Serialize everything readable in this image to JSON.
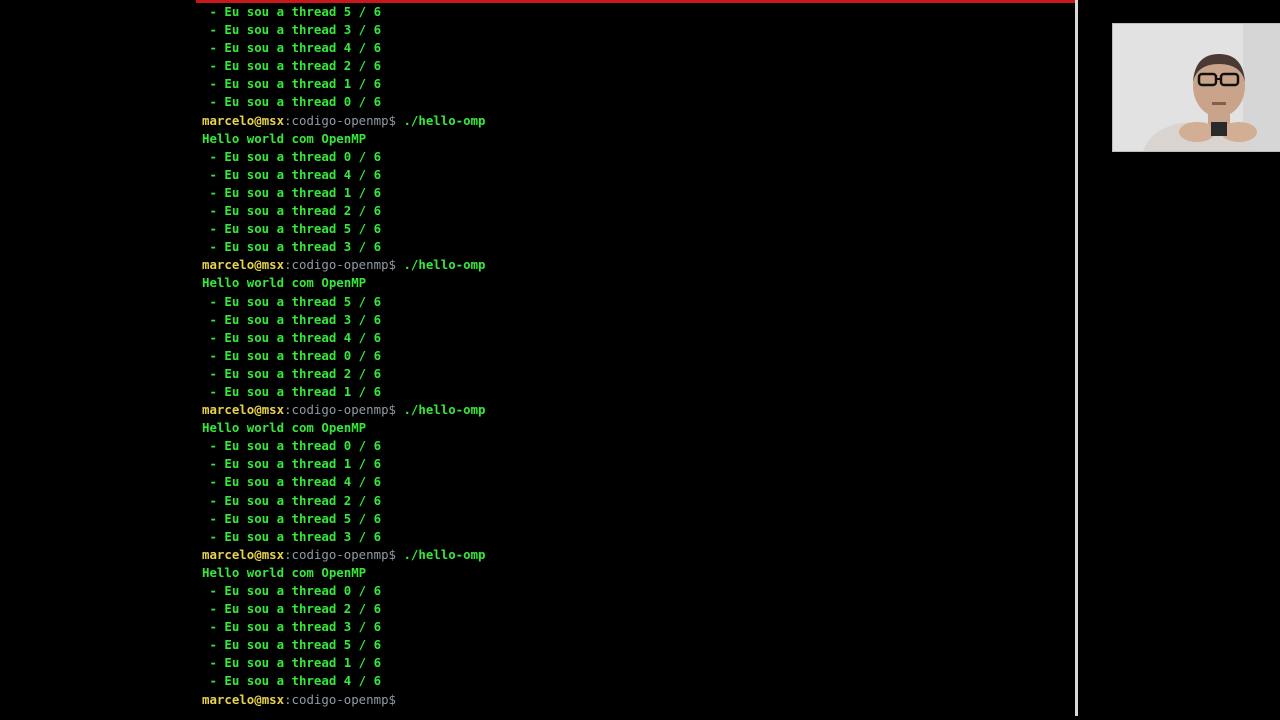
{
  "terminal": {
    "prompt": {
      "user": "marcelo",
      "at": "@",
      "host": "msx",
      "colon": ":",
      "path": "codigo-openmp",
      "dollar": "$"
    },
    "lines": [
      {
        "type": "output",
        "text": " - Eu sou a thread 5 / 6"
      },
      {
        "type": "output",
        "text": " - Eu sou a thread 3 / 6"
      },
      {
        "type": "output",
        "text": " - Eu sou a thread 4 / 6"
      },
      {
        "type": "output",
        "text": " - Eu sou a thread 2 / 6"
      },
      {
        "type": "output",
        "text": " - Eu sou a thread 1 / 6"
      },
      {
        "type": "output",
        "text": " - Eu sou a thread 0 / 6"
      },
      {
        "type": "prompt",
        "cmd": " ./hello-omp"
      },
      {
        "type": "output",
        "text": "Hello world com OpenMP"
      },
      {
        "type": "output",
        "text": " - Eu sou a thread 0 / 6"
      },
      {
        "type": "output",
        "text": " - Eu sou a thread 4 / 6"
      },
      {
        "type": "output",
        "text": " - Eu sou a thread 1 / 6"
      },
      {
        "type": "output",
        "text": " - Eu sou a thread 2 / 6"
      },
      {
        "type": "output",
        "text": " - Eu sou a thread 5 / 6"
      },
      {
        "type": "output",
        "text": " - Eu sou a thread 3 / 6"
      },
      {
        "type": "prompt",
        "cmd": " ./hello-omp"
      },
      {
        "type": "output",
        "text": "Hello world com OpenMP"
      },
      {
        "type": "output",
        "text": " - Eu sou a thread 5 / 6"
      },
      {
        "type": "output",
        "text": " - Eu sou a thread 3 / 6"
      },
      {
        "type": "output",
        "text": " - Eu sou a thread 4 / 6"
      },
      {
        "type": "output",
        "text": " - Eu sou a thread 0 / 6"
      },
      {
        "type": "output",
        "text": " - Eu sou a thread 2 / 6"
      },
      {
        "type": "output",
        "text": " - Eu sou a thread 1 / 6"
      },
      {
        "type": "prompt",
        "cmd": " ./hello-omp"
      },
      {
        "type": "output",
        "text": "Hello world com OpenMP"
      },
      {
        "type": "output",
        "text": " - Eu sou a thread 0 / 6"
      },
      {
        "type": "output",
        "text": " - Eu sou a thread 1 / 6"
      },
      {
        "type": "output",
        "text": " - Eu sou a thread 4 / 6"
      },
      {
        "type": "output",
        "text": " - Eu sou a thread 2 / 6"
      },
      {
        "type": "output",
        "text": " - Eu sou a thread 5 / 6"
      },
      {
        "type": "output",
        "text": " - Eu sou a thread 3 / 6"
      },
      {
        "type": "prompt",
        "cmd": " ./hello-omp"
      },
      {
        "type": "output",
        "text": "Hello world com OpenMP"
      },
      {
        "type": "output",
        "text": " - Eu sou a thread 0 / 6"
      },
      {
        "type": "output",
        "text": " - Eu sou a thread 2 / 6"
      },
      {
        "type": "output",
        "text": " - Eu sou a thread 3 / 6"
      },
      {
        "type": "output",
        "text": " - Eu sou a thread 5 / 6"
      },
      {
        "type": "output",
        "text": " - Eu sou a thread 1 / 6"
      },
      {
        "type": "output",
        "text": " - Eu sou a thread 4 / 6"
      },
      {
        "type": "prompt",
        "cmd": ""
      }
    ],
    "colors": {
      "output": "#35e83a",
      "user_host": "#e8d24a",
      "path": "#8f9aa6",
      "title_strip": "#c8181c",
      "background": "#000000"
    }
  }
}
